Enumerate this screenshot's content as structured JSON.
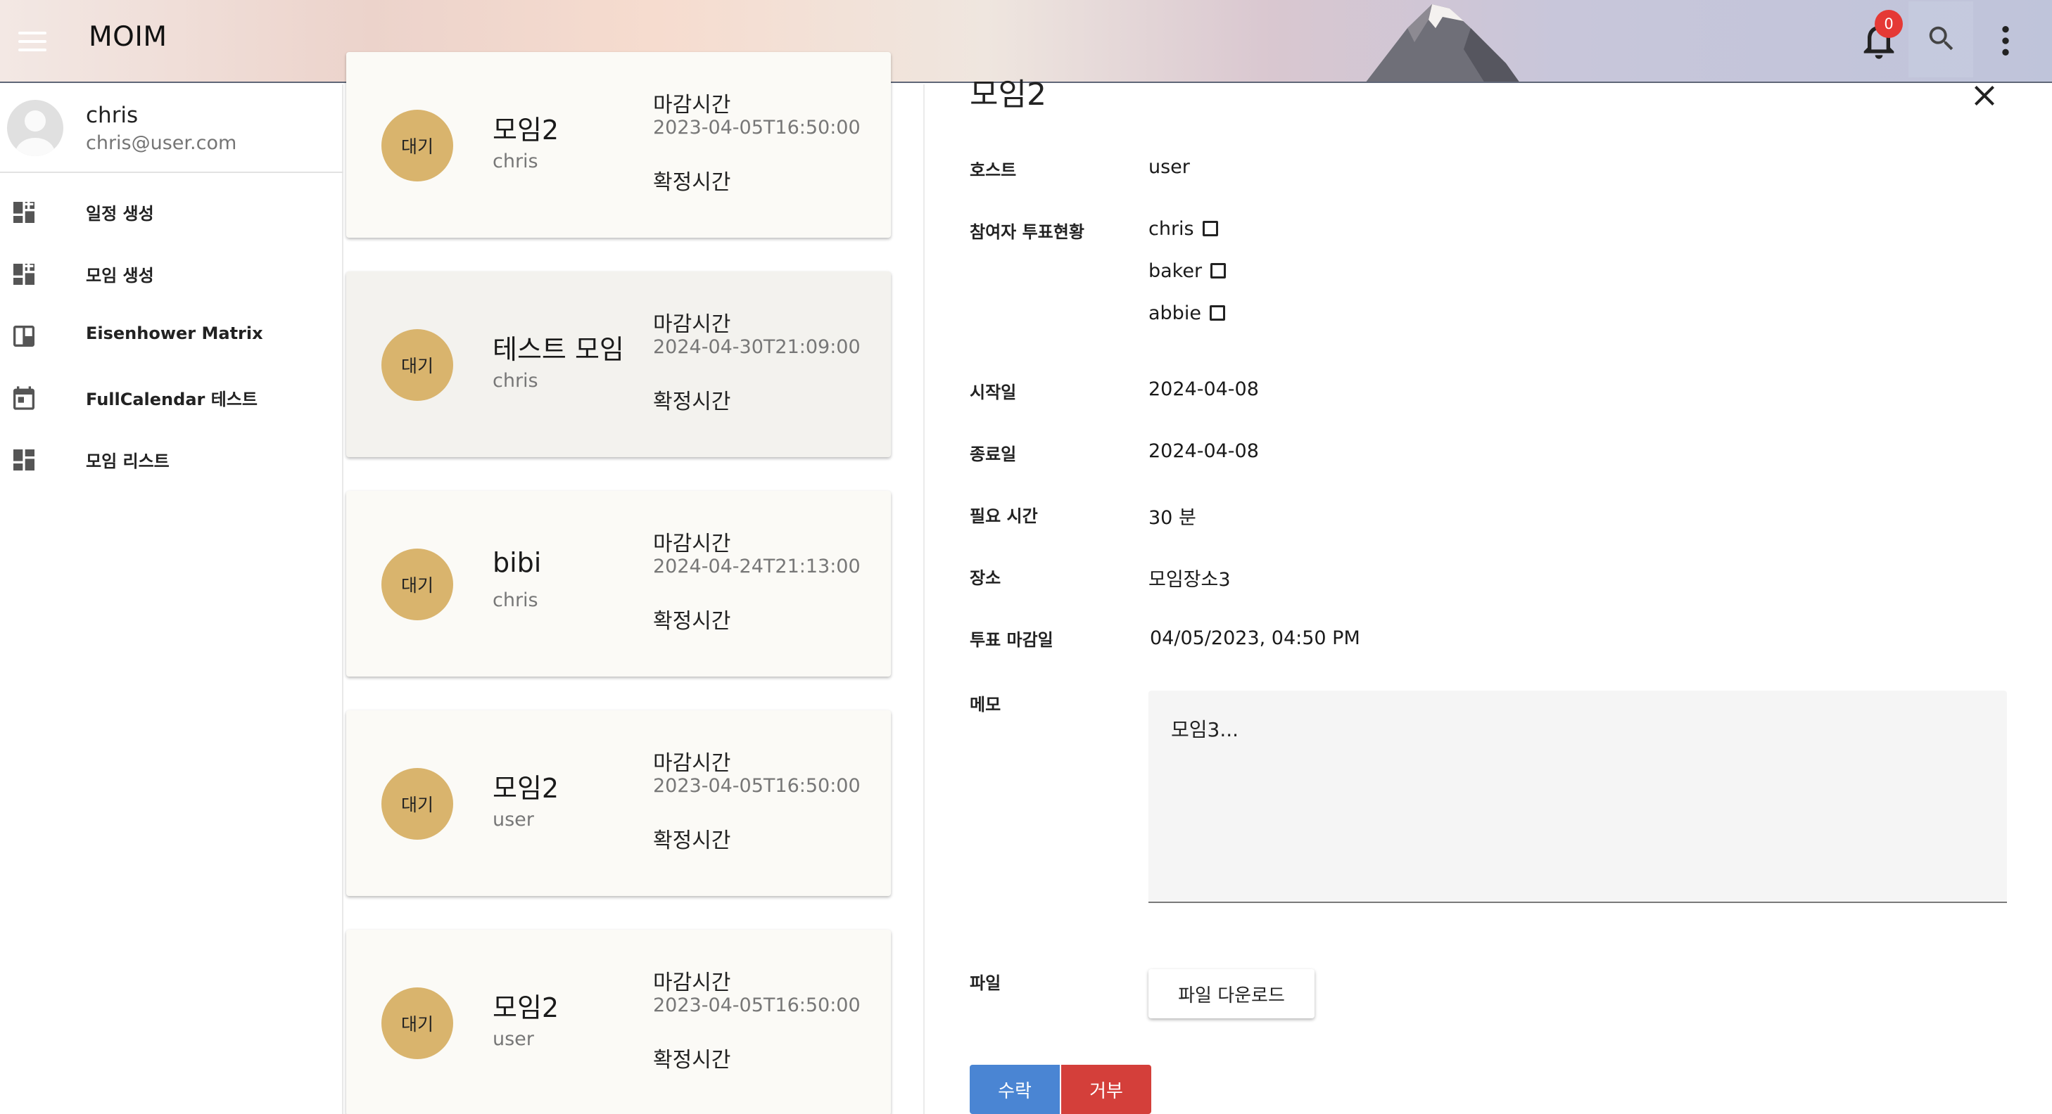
{
  "app": {
    "title": "MOIM",
    "notification_count": "0",
    "icons": [
      "menu-icon",
      "bell-icon",
      "search-icon",
      "more-vertical-icon"
    ]
  },
  "user": {
    "name": "chris",
    "email": "chris@user.com"
  },
  "sidebar": {
    "items": [
      {
        "label": "일정 생성",
        "icon": "dashboard-add-icon"
      },
      {
        "label": "모임 생성",
        "icon": "dashboard-add-icon"
      },
      {
        "label": "Eisenhower Matrix",
        "icon": "board-icon"
      },
      {
        "label": "FullCalendar 테스트",
        "icon": "calendar-icon"
      },
      {
        "label": "모임 리스트",
        "icon": "dashboard-icon"
      }
    ]
  },
  "cards": [
    {
      "status": "대기",
      "title": "모임2",
      "host": "chris",
      "deadline_label": "마감시간",
      "deadline": "2023-04-05T16:50:00",
      "confirm_label": "확정시간"
    },
    {
      "status": "대기",
      "title": "테스트 모임",
      "host": "chris",
      "deadline_label": "마감시간",
      "deadline": "2024-04-30T21:09:00",
      "confirm_label": "확정시간"
    },
    {
      "status": "대기",
      "title": "bibi",
      "host": "chris",
      "deadline_label": "마감시간",
      "deadline": "2024-04-24T21:13:00",
      "confirm_label": "확정시간"
    },
    {
      "status": "대기",
      "title": "모임2",
      "host": "user",
      "deadline_label": "마감시간",
      "deadline": "2023-04-05T16:50:00",
      "confirm_label": "확정시간"
    },
    {
      "status": "대기",
      "title": "모임2",
      "host": "user",
      "deadline_label": "마감시간",
      "deadline": "2023-04-05T16:50:00",
      "confirm_label": "확정시간"
    }
  ],
  "detail": {
    "title": "모임2",
    "host_label": "호스트",
    "host": "user",
    "voters_label": "참여자 투표현황",
    "voters": [
      {
        "name": "chris",
        "voted": false
      },
      {
        "name": "baker",
        "voted": false
      },
      {
        "name": "abbie",
        "voted": false
      }
    ],
    "start_label": "시작일",
    "start": "2024-04-08",
    "end_label": "종료일",
    "end": "2024-04-08",
    "duration_label": "필요 시간",
    "duration": "30 분",
    "place_label": "장소",
    "place": "모임장소3",
    "vote_deadline_label": "투표 마감일",
    "vote_deadline": "04/05/2023, 04:50 PM",
    "memo_label": "메모",
    "memo": "모임3...",
    "file_label": "파일",
    "file_button": "파일 다운로드",
    "accept_button": "수락",
    "reject_button": "거부"
  },
  "colors": {
    "status_badge": "#d9b46d",
    "accept": "#4a85d3",
    "reject": "#d43f3a",
    "notification_badge": "#e53935"
  }
}
